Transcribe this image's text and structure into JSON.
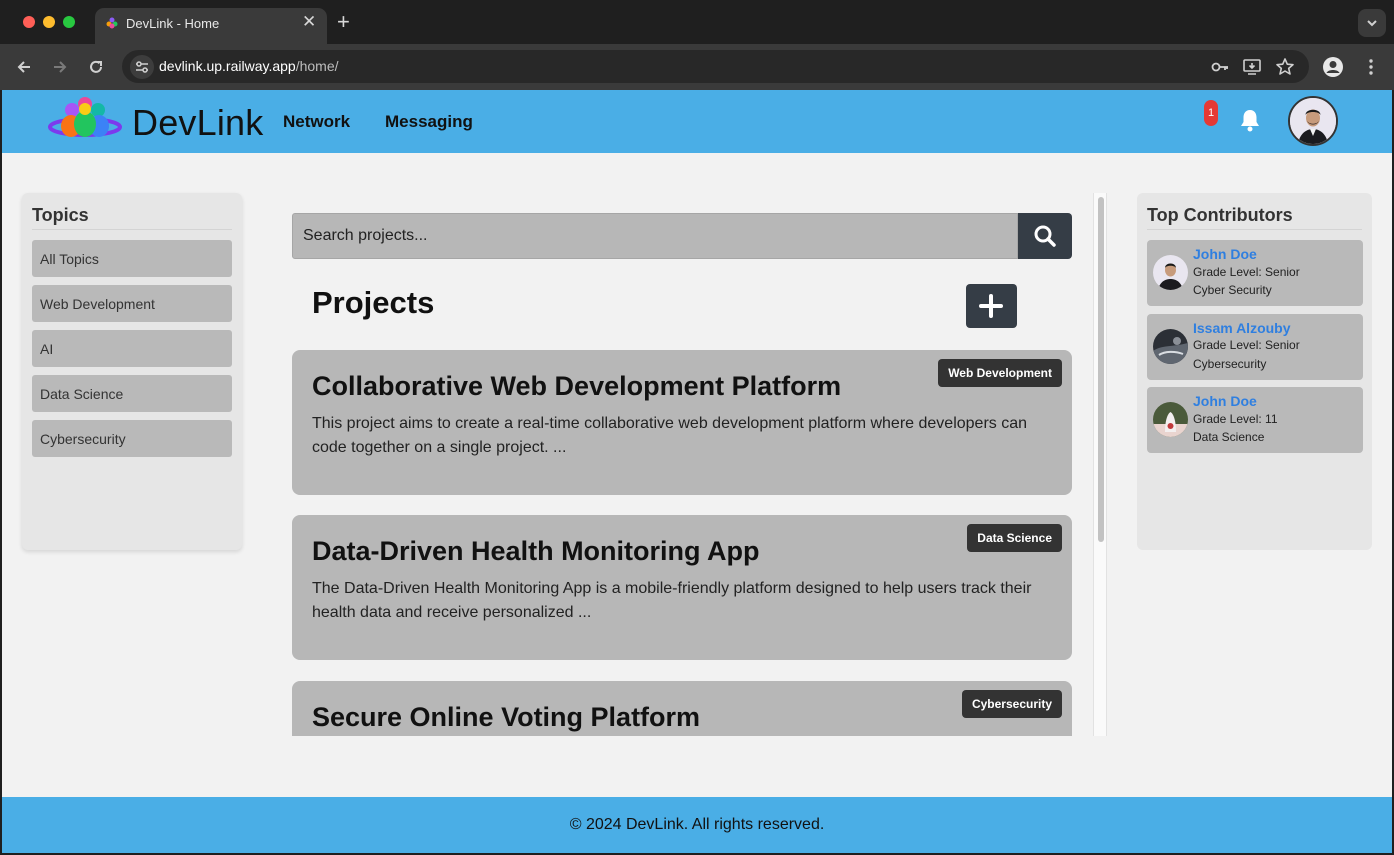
{
  "browser": {
    "tab_title": "DevLink - Home",
    "url_host": "devlink.up.railway.app",
    "url_path": "/home/",
    "tab_close": "✕",
    "new_tab": "+"
  },
  "header": {
    "brand": "DevLink",
    "nav": [
      "Network",
      "Messaging"
    ],
    "notification_count": "1",
    "accent_color": "#4aaee6"
  },
  "sidebar": {
    "title": "Topics",
    "topics": [
      "All Topics",
      "Web Development",
      "AI",
      "Data Science",
      "Cybersecurity"
    ]
  },
  "search": {
    "placeholder": "Search projects..."
  },
  "projects": {
    "title": "Projects",
    "items": [
      {
        "title": "Collaborative Web Development Platform",
        "description": "This project aims to create a real-time collaborative web development platform where developers can code together on a single project. ...",
        "tag": "Web Development"
      },
      {
        "title": "Data-Driven Health Monitoring App",
        "description": "The Data-Driven Health Monitoring App is a mobile-friendly platform designed to help users track their health data and receive personalized ...",
        "tag": "Data Science"
      },
      {
        "title": "Secure Online Voting Platform",
        "description": "",
        "tag": "Cybersecurity"
      }
    ]
  },
  "contributors": {
    "title": "Top Contributors",
    "items": [
      {
        "name": "John Doe",
        "grade": "Grade Level: Senior",
        "topic": "Cyber Security"
      },
      {
        "name": "Issam Alzouby",
        "grade": "Grade Level: Senior",
        "topic": "Cybersecurity"
      },
      {
        "name": "John Doe",
        "grade": "Grade Level: 11",
        "topic": "Data Science"
      }
    ]
  },
  "footer": {
    "text": "© 2024 DevLink. All rights reserved."
  }
}
